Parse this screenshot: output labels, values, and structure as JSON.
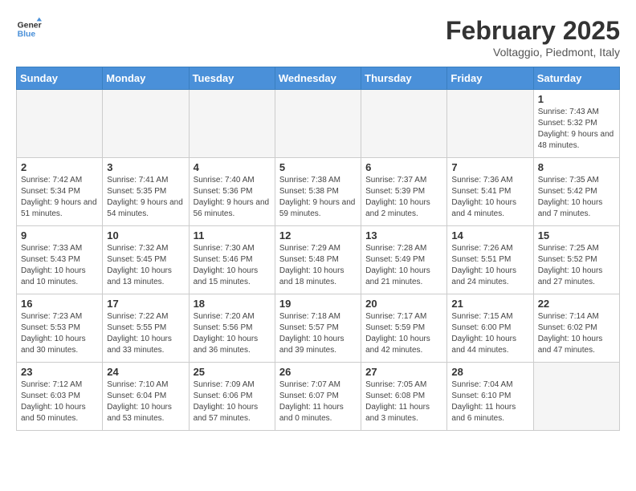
{
  "header": {
    "logo_line1": "General",
    "logo_line2": "Blue",
    "month_title": "February 2025",
    "location": "Voltaggio, Piedmont, Italy"
  },
  "days_of_week": [
    "Sunday",
    "Monday",
    "Tuesday",
    "Wednesday",
    "Thursday",
    "Friday",
    "Saturday"
  ],
  "weeks": [
    [
      {
        "day": "",
        "info": ""
      },
      {
        "day": "",
        "info": ""
      },
      {
        "day": "",
        "info": ""
      },
      {
        "day": "",
        "info": ""
      },
      {
        "day": "",
        "info": ""
      },
      {
        "day": "",
        "info": ""
      },
      {
        "day": "1",
        "info": "Sunrise: 7:43 AM\nSunset: 5:32 PM\nDaylight: 9 hours and 48 minutes."
      }
    ],
    [
      {
        "day": "2",
        "info": "Sunrise: 7:42 AM\nSunset: 5:34 PM\nDaylight: 9 hours and 51 minutes."
      },
      {
        "day": "3",
        "info": "Sunrise: 7:41 AM\nSunset: 5:35 PM\nDaylight: 9 hours and 54 minutes."
      },
      {
        "day": "4",
        "info": "Sunrise: 7:40 AM\nSunset: 5:36 PM\nDaylight: 9 hours and 56 minutes."
      },
      {
        "day": "5",
        "info": "Sunrise: 7:38 AM\nSunset: 5:38 PM\nDaylight: 9 hours and 59 minutes."
      },
      {
        "day": "6",
        "info": "Sunrise: 7:37 AM\nSunset: 5:39 PM\nDaylight: 10 hours and 2 minutes."
      },
      {
        "day": "7",
        "info": "Sunrise: 7:36 AM\nSunset: 5:41 PM\nDaylight: 10 hours and 4 minutes."
      },
      {
        "day": "8",
        "info": "Sunrise: 7:35 AM\nSunset: 5:42 PM\nDaylight: 10 hours and 7 minutes."
      }
    ],
    [
      {
        "day": "9",
        "info": "Sunrise: 7:33 AM\nSunset: 5:43 PM\nDaylight: 10 hours and 10 minutes."
      },
      {
        "day": "10",
        "info": "Sunrise: 7:32 AM\nSunset: 5:45 PM\nDaylight: 10 hours and 13 minutes."
      },
      {
        "day": "11",
        "info": "Sunrise: 7:30 AM\nSunset: 5:46 PM\nDaylight: 10 hours and 15 minutes."
      },
      {
        "day": "12",
        "info": "Sunrise: 7:29 AM\nSunset: 5:48 PM\nDaylight: 10 hours and 18 minutes."
      },
      {
        "day": "13",
        "info": "Sunrise: 7:28 AM\nSunset: 5:49 PM\nDaylight: 10 hours and 21 minutes."
      },
      {
        "day": "14",
        "info": "Sunrise: 7:26 AM\nSunset: 5:51 PM\nDaylight: 10 hours and 24 minutes."
      },
      {
        "day": "15",
        "info": "Sunrise: 7:25 AM\nSunset: 5:52 PM\nDaylight: 10 hours and 27 minutes."
      }
    ],
    [
      {
        "day": "16",
        "info": "Sunrise: 7:23 AM\nSunset: 5:53 PM\nDaylight: 10 hours and 30 minutes."
      },
      {
        "day": "17",
        "info": "Sunrise: 7:22 AM\nSunset: 5:55 PM\nDaylight: 10 hours and 33 minutes."
      },
      {
        "day": "18",
        "info": "Sunrise: 7:20 AM\nSunset: 5:56 PM\nDaylight: 10 hours and 36 minutes."
      },
      {
        "day": "19",
        "info": "Sunrise: 7:18 AM\nSunset: 5:57 PM\nDaylight: 10 hours and 39 minutes."
      },
      {
        "day": "20",
        "info": "Sunrise: 7:17 AM\nSunset: 5:59 PM\nDaylight: 10 hours and 42 minutes."
      },
      {
        "day": "21",
        "info": "Sunrise: 7:15 AM\nSunset: 6:00 PM\nDaylight: 10 hours and 44 minutes."
      },
      {
        "day": "22",
        "info": "Sunrise: 7:14 AM\nSunset: 6:02 PM\nDaylight: 10 hours and 47 minutes."
      }
    ],
    [
      {
        "day": "23",
        "info": "Sunrise: 7:12 AM\nSunset: 6:03 PM\nDaylight: 10 hours and 50 minutes."
      },
      {
        "day": "24",
        "info": "Sunrise: 7:10 AM\nSunset: 6:04 PM\nDaylight: 10 hours and 53 minutes."
      },
      {
        "day": "25",
        "info": "Sunrise: 7:09 AM\nSunset: 6:06 PM\nDaylight: 10 hours and 57 minutes."
      },
      {
        "day": "26",
        "info": "Sunrise: 7:07 AM\nSunset: 6:07 PM\nDaylight: 11 hours and 0 minutes."
      },
      {
        "day": "27",
        "info": "Sunrise: 7:05 AM\nSunset: 6:08 PM\nDaylight: 11 hours and 3 minutes."
      },
      {
        "day": "28",
        "info": "Sunrise: 7:04 AM\nSunset: 6:10 PM\nDaylight: 11 hours and 6 minutes."
      },
      {
        "day": "",
        "info": ""
      }
    ]
  ]
}
